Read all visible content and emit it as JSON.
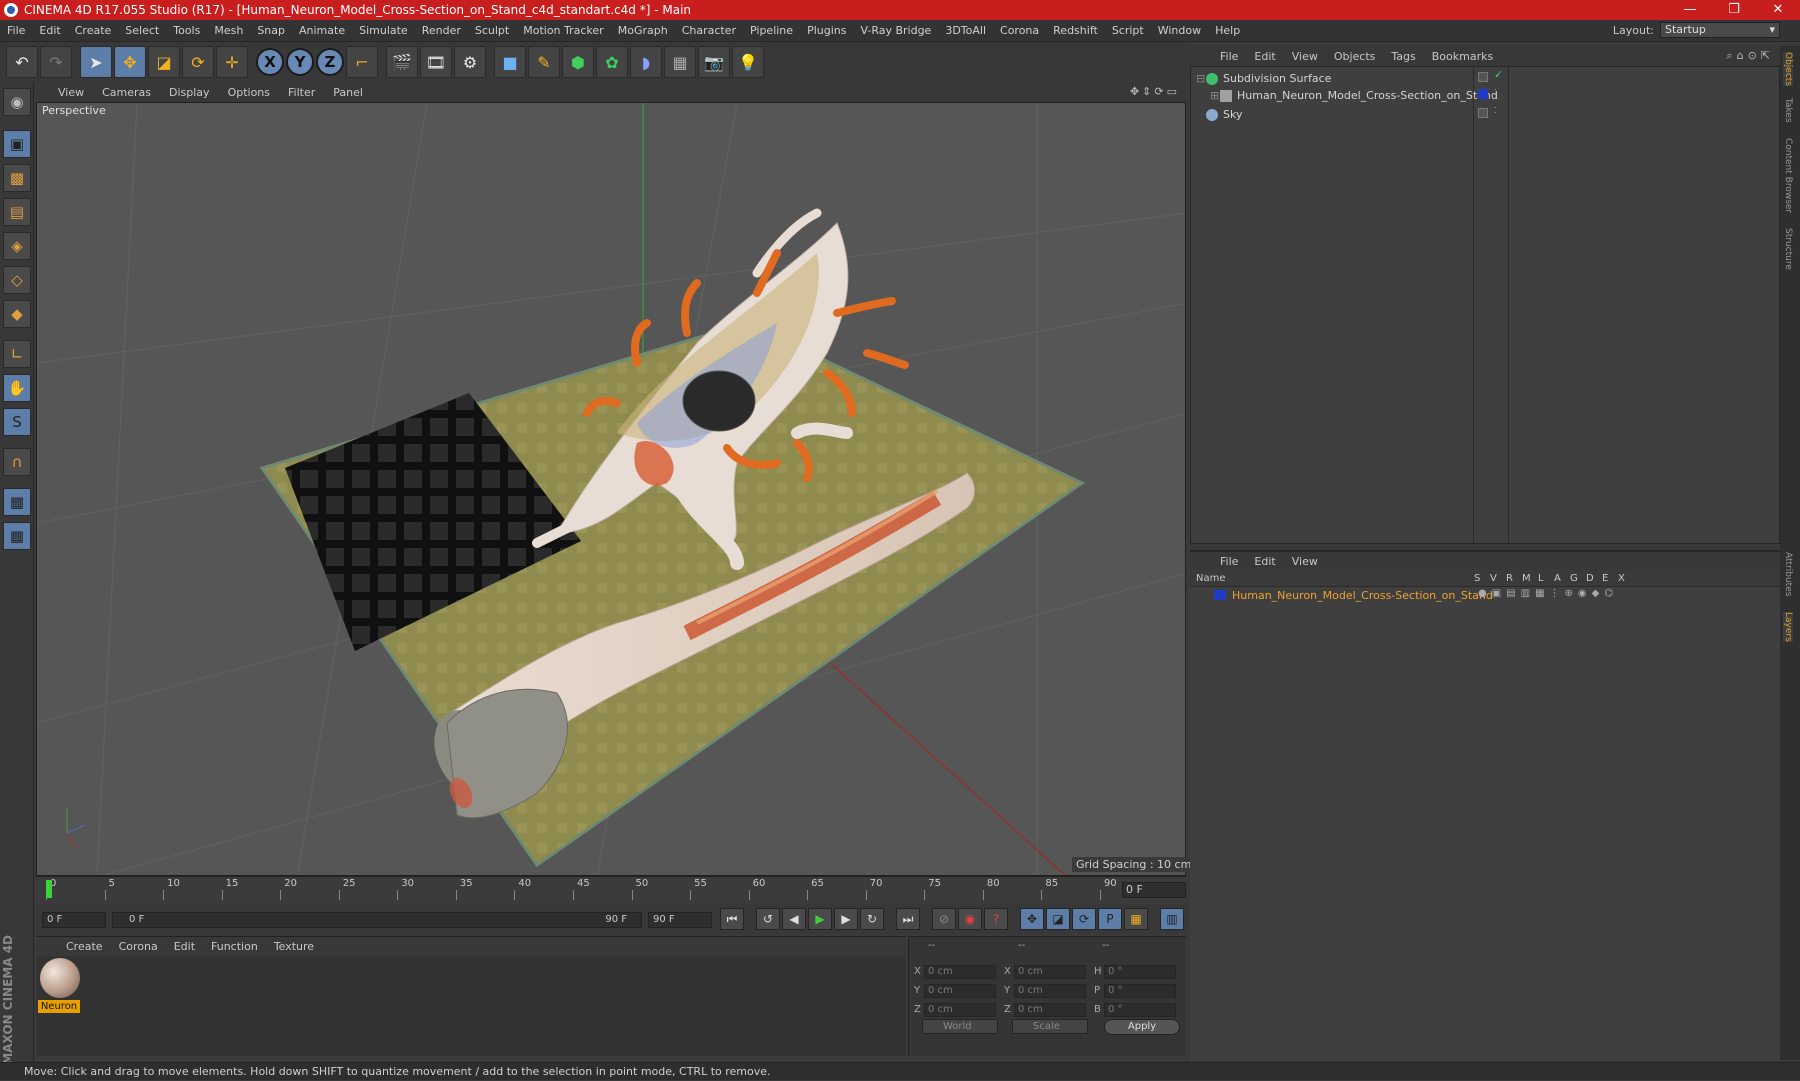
{
  "window": {
    "title": "CINEMA 4D R17.055 Studio (R17) - [Human_Neuron_Model_Cross-Section_on_Stand_c4d_standart.c4d *] - Main",
    "controls": [
      "—",
      "❐",
      "✕"
    ]
  },
  "menubar": {
    "items": [
      "File",
      "Edit",
      "Create",
      "Select",
      "Tools",
      "Mesh",
      "Snap",
      "Animate",
      "Simulate",
      "Render",
      "Sculpt",
      "Motion Tracker",
      "MoGraph",
      "Character",
      "Pipeline",
      "Plugins",
      "V-Ray Bridge",
      "3DToAll",
      "Corona",
      "Redshift",
      "Script",
      "Window",
      "Help"
    ],
    "layout_label": "Layout:",
    "layout_value": "Startup"
  },
  "toolbar": {
    "axis_x": "X",
    "axis_y": "Y",
    "axis_z": "Z"
  },
  "viewport": {
    "menu": [
      "View",
      "Cameras",
      "Display",
      "Options",
      "Filter",
      "Panel"
    ],
    "label": "Perspective",
    "grid_spacing": "Grid Spacing : 10 cm"
  },
  "timeline": {
    "ticks": [
      "0",
      "5",
      "10",
      "15",
      "20",
      "25",
      "30",
      "35",
      "40",
      "45",
      "50",
      "55",
      "60",
      "65",
      "70",
      "75",
      "80",
      "85",
      "90"
    ],
    "current_frame": "0 F",
    "start_field": "0 F",
    "slider_start": "0 F",
    "slider_end": "90 F",
    "end_field": "90 F"
  },
  "material_manager": {
    "menu": [
      "Create",
      "Corona",
      "Edit",
      "Function",
      "Texture"
    ],
    "material_name": "Neuron"
  },
  "coordinates": {
    "headers": [
      "--",
      "--",
      "--"
    ],
    "rows": [
      {
        "a": "X",
        "v1": "0 cm",
        "b": "X",
        "v2": "0 cm",
        "c": "H",
        "v3": "0 °"
      },
      {
        "a": "Y",
        "v1": "0 cm",
        "b": "Y",
        "v2": "0 cm",
        "c": "P",
        "v3": "0 °"
      },
      {
        "a": "Z",
        "v1": "0 cm",
        "b": "Z",
        "v2": "0 cm",
        "c": "B",
        "v3": "0 °"
      }
    ],
    "world": "World",
    "scale": "Scale",
    "apply": "Apply"
  },
  "object_manager": {
    "menu": [
      "File",
      "Edit",
      "View",
      "Objects",
      "Tags",
      "Bookmarks"
    ],
    "objects": [
      {
        "name": "Subdivision Surface",
        "color": "#3cc070"
      },
      {
        "name": "Human_Neuron_Model_Cross-Section_on_Stand",
        "color": "#a0a0a0"
      },
      {
        "name": "Sky",
        "color": "#8aaad0"
      }
    ]
  },
  "layer_manager": {
    "menu": [
      "File",
      "Edit",
      "View"
    ],
    "columns": [
      "Name",
      "S",
      "V",
      "R",
      "M",
      "L",
      "A",
      "G",
      "D",
      "E",
      "X"
    ],
    "layer_name": "Human_Neuron_Model_Cross-Section_on_Stand",
    "layer_color": "#1e3cc8"
  },
  "right_tabs": [
    "Objects",
    "Takes",
    "Content Browser",
    "Structure",
    "Attributes",
    "Layers"
  ],
  "maxon_logo": "MAXON CINEMA 4D",
  "status": "Move: Click and drag to move elements. Hold down SHIFT to quantize movement / add to the selection in point mode, CTRL to remove."
}
